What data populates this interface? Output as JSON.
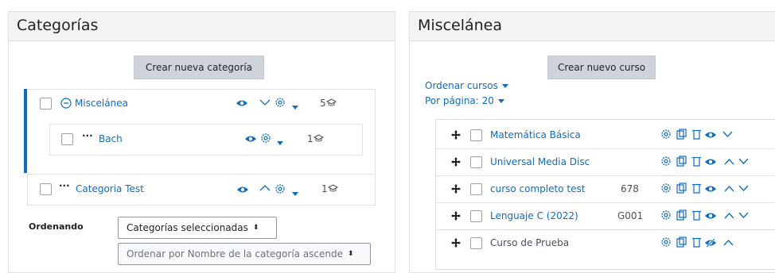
{
  "categories_panel": {
    "title": "Categorías",
    "create_button": "Crear nueva categoría",
    "items": [
      {
        "name": "Miscelánea",
        "count": "5"
      },
      {
        "name": "Bach",
        "count": "1"
      },
      {
        "name": "Categoria Test",
        "count": "1"
      }
    ],
    "sorting": {
      "label": "Ordenando",
      "select_value": "Categorías seleccionadas",
      "sort_value": "Ordenar por Nombre de la categoría ascende"
    }
  },
  "courses_panel": {
    "title": "Miscelánea",
    "create_button": "Crear nuevo curso",
    "sort_courses": "Ordenar cursos",
    "per_page": "Por página: 20",
    "courses": [
      {
        "name": "Matemática Básica",
        "idnumber": ""
      },
      {
        "name": "Universal Media Disc",
        "idnumber": ""
      },
      {
        "name": "curso completo test",
        "idnumber": "678"
      },
      {
        "name": "Lenguaje C (2022)",
        "idnumber": "G001"
      },
      {
        "name": "Curso de Prueba",
        "idnumber": ""
      }
    ]
  },
  "colors": {
    "link": "#0f6cbf",
    "active_bar": "#0f6cbf",
    "header_bg": "#f1f3f5",
    "button_bg": "#ced4da"
  }
}
